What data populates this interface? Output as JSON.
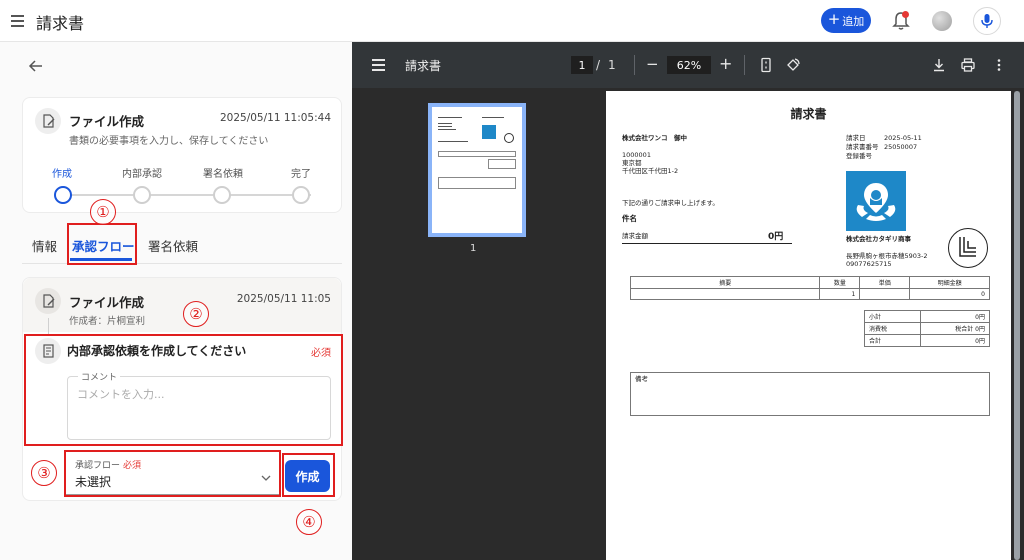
{
  "app": {
    "title": "請求書",
    "add_label": "追加"
  },
  "card1": {
    "title": "ファイル作成",
    "datetime": "2025/05/11 11:05:44",
    "description": "書類の必要事項を入力し、保存してください",
    "steps": [
      "作成",
      "内部承認",
      "署名依頼",
      "完了"
    ],
    "active_step": 0
  },
  "tabs": [
    "情報",
    "承認フロー",
    "署名依頼"
  ],
  "active_tab": 1,
  "card2": {
    "title": "ファイル作成",
    "datetime": "2025/05/11 11:05",
    "author": "作成者：片桐宣利",
    "request_title": "内部承認依頼を作成してください",
    "required": "必須",
    "comment_label": "コメント",
    "comment_placeholder": "コメントを入力...",
    "comment_value": ""
  },
  "flow_select": {
    "label": "承認フロー",
    "required": "必須",
    "value": "未選択"
  },
  "create_label": "作成",
  "callouts": [
    "①",
    "②",
    "③",
    "④"
  ],
  "viewer": {
    "title": "請求書",
    "page_current": "1",
    "page_sep": "/",
    "page_total": "1",
    "zoom": "62%",
    "thumb_label": "1"
  },
  "invoice": {
    "title": "請求書",
    "to": "株式会社ワンコ　御中",
    "zip": "1000001",
    "pref": "東京都",
    "address": "千代田区千代田1-2",
    "date_label": "請求日",
    "date_value": "2025-05-11",
    "no_label": "請求書番号",
    "no_value": "25050007",
    "reg_label": "登録番号",
    "greeting": "下記の通りご請求申し上げます。",
    "subject_label": "件名",
    "amount_label": "請求金額",
    "amount_value": "0円",
    "company": "株式会社カタギリ商事",
    "company_address": "長野県駒ヶ根市赤穂5903-2",
    "company_phone": "09077625715",
    "columns": [
      "摘要",
      "数量",
      "単価",
      "明細金額"
    ],
    "row": [
      "",
      "1",
      "",
      "0"
    ],
    "subtotal_label": "小計",
    "subtotal_value": "0円",
    "tax_label": "消費税",
    "tax_value": "税合計 0円",
    "total_label": "合計",
    "total_value": "0円",
    "memo_label": "備考"
  },
  "colors": {
    "accent": "#1a56db",
    "required": "#e53935",
    "annotation": "#e01e1e"
  },
  "icons": [
    "menu-icon",
    "plus-icon",
    "bell-icon",
    "avatar",
    "mic-icon",
    "back-arrow-icon",
    "document-edit-icon",
    "document-list-icon",
    "chevron-down-icon",
    "download-icon",
    "print-icon",
    "more-vert-icon",
    "fit-page-icon",
    "rotate-icon"
  ]
}
